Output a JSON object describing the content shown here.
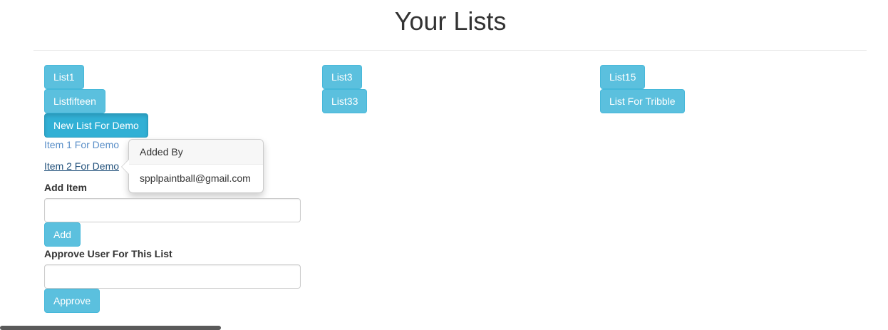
{
  "page": {
    "title": "Your Lists"
  },
  "lists": [
    {
      "label": "List1"
    },
    {
      "label": "List3"
    },
    {
      "label": "List15"
    },
    {
      "label": "Listfifteen"
    },
    {
      "label": "List33"
    },
    {
      "label": "List For Tribble"
    },
    {
      "label": "New List For Demo",
      "active": true
    }
  ],
  "items": [
    {
      "label": "Item 1 For Demo"
    },
    {
      "label": "Item 2 For Demo",
      "hovered": true
    }
  ],
  "popover": {
    "title": "Added By",
    "content": "spplpaintball@gmail.com"
  },
  "add_item": {
    "label": "Add Item",
    "value": "",
    "placeholder": "",
    "button": "Add"
  },
  "approve_user": {
    "label": "Approve User For This List",
    "value": "",
    "placeholder": "",
    "button": "Approve"
  },
  "colors": {
    "button_bg": "#5bc0de",
    "button_border": "#46b8da",
    "link": "#5a8fc8",
    "link_hover": "#23527c"
  }
}
